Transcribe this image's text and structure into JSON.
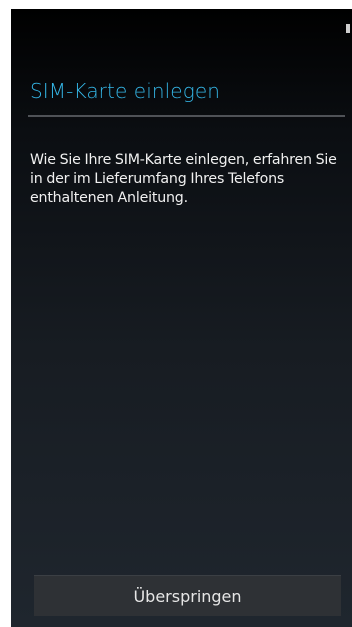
{
  "setup": {
    "title": "SIM-Karte einlegen",
    "instructions": "Wie Sie Ihre SIM-Karte einlegen, erfahren Sie in der im Lieferumfang Ihres Telefons enthaltenen Anleitung.",
    "skip_label": "Überspringen"
  },
  "colors": {
    "accent": "#34b5e5",
    "background_top": "#000000",
    "background_bottom": "#1f262e",
    "button": "#2e3135"
  }
}
